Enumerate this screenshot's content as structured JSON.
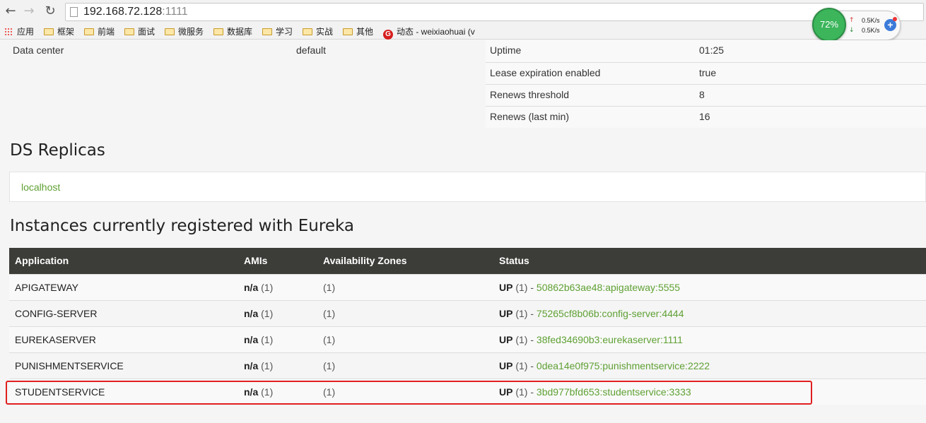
{
  "browser": {
    "url_host": "192.168.72.128",
    "url_port": ":1111",
    "bookmarks": [
      {
        "label": "应用",
        "type": "apps"
      },
      {
        "label": "框架",
        "type": "folder"
      },
      {
        "label": "前端",
        "type": "folder"
      },
      {
        "label": "面试",
        "type": "folder"
      },
      {
        "label": "微服务",
        "type": "folder"
      },
      {
        "label": "数据库",
        "type": "folder"
      },
      {
        "label": "学习",
        "type": "folder"
      },
      {
        "label": "实战",
        "type": "folder"
      },
      {
        "label": "其他",
        "type": "folder"
      },
      {
        "label": "动态 - weixiaohuai (v",
        "type": "site"
      }
    ]
  },
  "net_widget": {
    "percent": "72%",
    "upload": "0.5K/s",
    "download": "0.5K/s"
  },
  "environment": {
    "left_label": "Data center",
    "left_value": "default",
    "status_rows": [
      {
        "key": "Uptime",
        "value": "01:25"
      },
      {
        "key": "Lease expiration enabled",
        "value": "true"
      },
      {
        "key": "Renews threshold",
        "value": "8"
      },
      {
        "key": "Renews (last min)",
        "value": "16"
      }
    ]
  },
  "ds_replicas": {
    "title": "DS Replicas",
    "items": [
      "localhost"
    ]
  },
  "instances": {
    "title": "Instances currently registered with Eureka",
    "headers": [
      "Application",
      "AMIs",
      "Availability Zones",
      "Status"
    ],
    "rows": [
      {
        "application": "APIGATEWAY",
        "ami": "n/a",
        "ami_count": "(1)",
        "zones": "(1)",
        "status": "UP",
        "status_count": "(1) -",
        "instance": "50862b63ae48:apigateway:5555"
      },
      {
        "application": "CONFIG-SERVER",
        "ami": "n/a",
        "ami_count": "(1)",
        "zones": "(1)",
        "status": "UP",
        "status_count": "(1) -",
        "instance": "75265cf8b06b:config-server:4444"
      },
      {
        "application": "EUREKASERVER",
        "ami": "n/a",
        "ami_count": "(1)",
        "zones": "(1)",
        "status": "UP",
        "status_count": "(1) -",
        "instance": "38fed34690b3:eurekaserver:1111"
      },
      {
        "application": "PUNISHMENTSERVICE",
        "ami": "n/a",
        "ami_count": "(1)",
        "zones": "(1)",
        "status": "UP",
        "status_count": "(1) -",
        "instance": "0dea14e0f975:punishmentservice:2222"
      },
      {
        "application": "STUDENTSERVICE",
        "ami": "n/a",
        "ami_count": "(1)",
        "zones": "(1)",
        "status": "UP",
        "status_count": "(1) -",
        "instance": "3bd977bfd653:studentservice:3333"
      }
    ]
  }
}
